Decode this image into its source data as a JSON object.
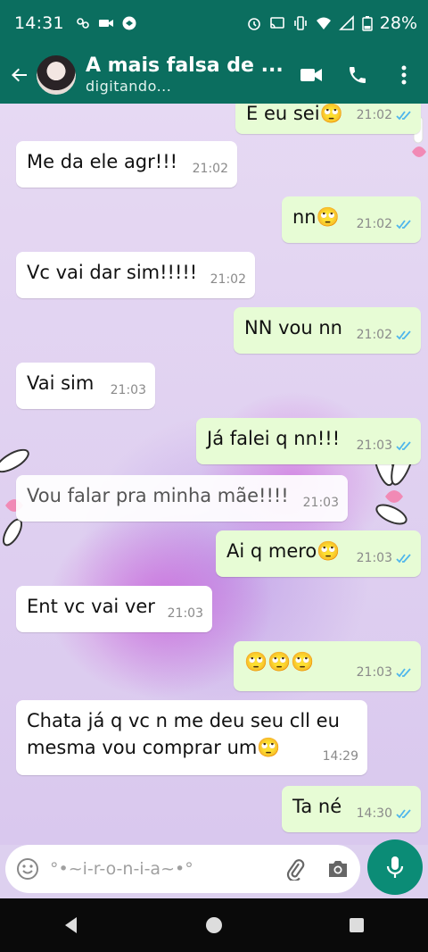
{
  "status_bar": {
    "time": "14:31",
    "battery": "28%"
  },
  "header": {
    "contact_name": "A mais falsa de ...",
    "status": "digitando..."
  },
  "messages": [
    {
      "side": "out",
      "text": "E eu sei🙄",
      "time": "21:02",
      "read": true
    },
    {
      "side": "in",
      "text": "Me da ele agr!!!",
      "time": "21:02"
    },
    {
      "side": "out",
      "text": "nn🙄",
      "time": "21:02",
      "read": true
    },
    {
      "side": "in",
      "text": "Vc vai dar sim!!!!!",
      "time": "21:02"
    },
    {
      "side": "out",
      "text": "NN vou nn",
      "time": "21:02",
      "read": true
    },
    {
      "side": "in",
      "text": "Vai sim",
      "time": "21:03"
    },
    {
      "side": "out",
      "text": "Já falei q nn!!!",
      "time": "21:03",
      "read": true
    },
    {
      "side": "in",
      "text": "Vou falar pra minha mãe!!!!",
      "time": "21:03"
    },
    {
      "side": "out",
      "text": "Ai q mero🙄",
      "time": "21:03",
      "read": true
    },
    {
      "side": "in",
      "text": "Ent vc vai ver",
      "time": "21:03"
    },
    {
      "side": "out",
      "text": "🙄🙄🙄",
      "time": "21:03",
      "read": true
    },
    {
      "side": "in",
      "text": "Chata já q vc n me deu seu cll eu mesma vou comprar um🙄",
      "time": "14:29"
    },
    {
      "side": "out",
      "text": "Ta né",
      "time": "14:30",
      "read": true
    }
  ],
  "input": {
    "placeholder": "°•~i-r-o-n-i-a~•°"
  },
  "colors": {
    "header": "#0b6e5f",
    "outgoing_bubble": "#e7fcd5",
    "incoming_bubble": "#ffffff",
    "read_ticks": "#4fb6ec",
    "mic_button": "#0b8c76"
  },
  "icons": {
    "header": [
      "back-arrow-icon",
      "video-call-icon",
      "phone-icon",
      "more-vert-icon"
    ],
    "input": [
      "emoji-icon",
      "attach-icon",
      "camera-icon",
      "mic-icon"
    ],
    "nav": [
      "nav-back-icon",
      "nav-home-icon",
      "nav-recents-icon"
    ]
  }
}
